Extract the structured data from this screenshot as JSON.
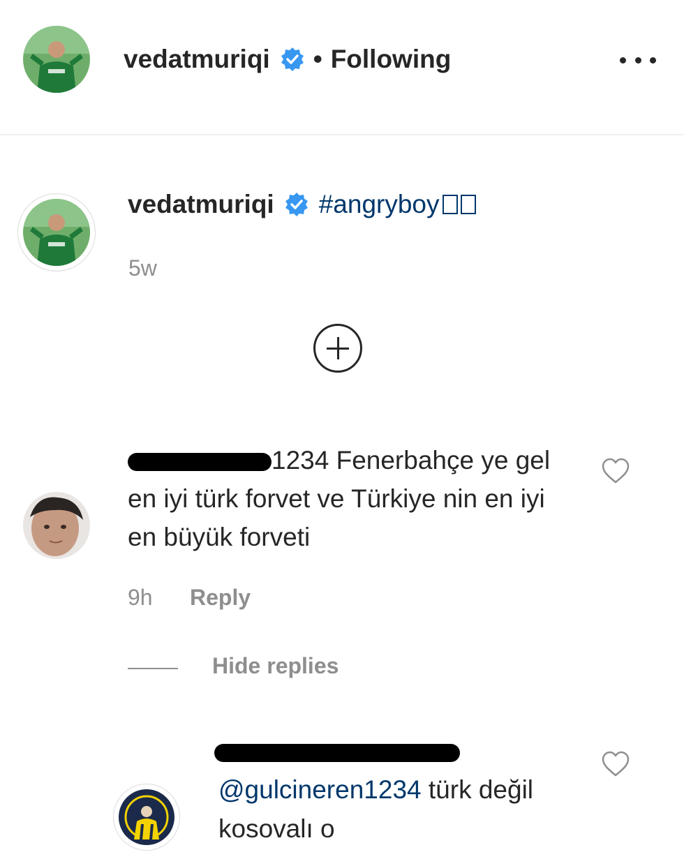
{
  "header": {
    "username": "vedatmuriqi",
    "separator": "•",
    "follow_status": "Following",
    "verified_icon": "verified-badge-icon",
    "more_icon": "more-options-icon"
  },
  "caption": {
    "username": "vedatmuriqi",
    "hashtag": "#angryboy",
    "time": "5w"
  },
  "load_more_icon": "plus-circle-icon",
  "comments": [
    {
      "username_visible": "1234",
      "text": " Fenerbahçe ye gel en iyi türk forvet ve Türkiye nin en iyi en büyük forveti",
      "time": "9h",
      "reply_label": "Reply",
      "hide_replies_label": "Hide replies",
      "replies": [
        {
          "mention": "@gulcineren1234",
          "text": " türk değil kosovalı o"
        }
      ]
    }
  ],
  "colors": {
    "text": "#262626",
    "secondary": "#8e8e8e",
    "link": "#00376b",
    "verified": "#3897f0",
    "divider": "#efefef"
  }
}
